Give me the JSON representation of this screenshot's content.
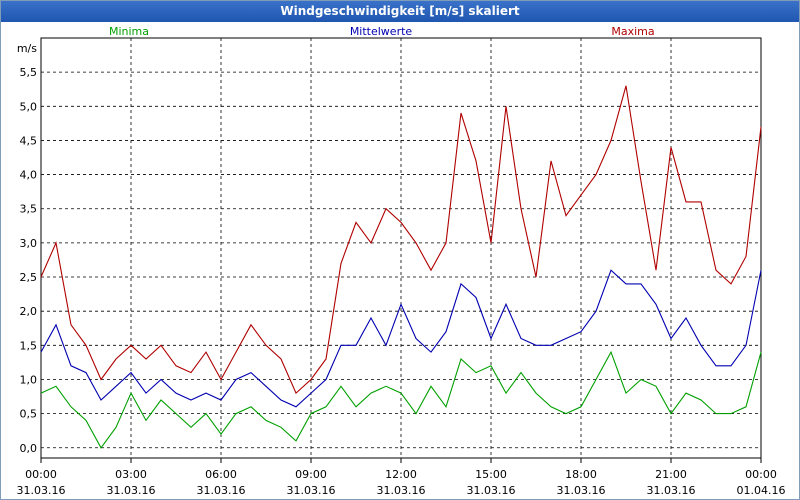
{
  "window": {
    "title": "Windgeschwindigkeit [m/s] skaliert"
  },
  "chart_data": {
    "type": "line",
    "title": "Windgeschwindigkeit [m/s] skaliert",
    "ylabel": "m/s",
    "ylim": [
      -0.15,
      6.0
    ],
    "yticks": [
      "0,0",
      "0,5",
      "1,0",
      "1,5",
      "2,0",
      "2,5",
      "3,0",
      "3,5",
      "4,0",
      "4,5",
      "5,0",
      "5,5"
    ],
    "ytick_values": [
      0,
      0.5,
      1.0,
      1.5,
      2.0,
      2.5,
      3.0,
      3.5,
      4.0,
      4.5,
      5.0,
      5.5
    ],
    "x_ticks": [
      {
        "time": "00:00",
        "date": "31.03.16"
      },
      {
        "time": "03:00",
        "date": "31.03.16"
      },
      {
        "time": "06:00",
        "date": "31.03.16"
      },
      {
        "time": "09:00",
        "date": "31.03.16"
      },
      {
        "time": "12:00",
        "date": "31.03.16"
      },
      {
        "time": "15:00",
        "date": "31.03.16"
      },
      {
        "time": "18:00",
        "date": "31.03.16"
      },
      {
        "time": "21:00",
        "date": "31.03.16"
      },
      {
        "time": "00:00",
        "date": "01.04.16"
      }
    ],
    "x_hours": [
      0,
      0.5,
      1,
      1.5,
      2,
      2.5,
      3,
      3.5,
      4,
      4.5,
      5,
      5.5,
      6,
      6.5,
      7,
      7.5,
      8,
      8.5,
      9,
      9.5,
      10,
      10.5,
      11,
      11.5,
      12,
      12.5,
      13,
      13.5,
      14,
      14.5,
      15,
      15.5,
      16,
      16.5,
      17,
      17.5,
      18,
      18.5,
      19,
      19.5,
      20,
      20.5,
      21,
      21.5,
      22,
      22.5,
      23,
      23.5,
      24
    ],
    "grid": true,
    "legend_position": "top",
    "series": [
      {
        "name": "Minima",
        "color": "#00a000",
        "values": [
          0.8,
          0.9,
          0.6,
          0.4,
          0.0,
          0.3,
          0.8,
          0.4,
          0.7,
          0.5,
          0.3,
          0.5,
          0.2,
          0.5,
          0.6,
          0.4,
          0.3,
          0.1,
          0.5,
          0.6,
          0.9,
          0.6,
          0.8,
          0.9,
          0.8,
          0.5,
          0.9,
          0.6,
          1.3,
          1.1,
          1.2,
          0.8,
          1.1,
          0.8,
          0.6,
          0.5,
          0.6,
          1.0,
          1.4,
          0.8,
          1.0,
          0.9,
          0.5,
          0.8,
          0.7,
          0.5,
          0.5,
          0.6,
          1.4
        ]
      },
      {
        "name": "Mittelwerte",
        "color": "#0000b0",
        "values": [
          1.4,
          1.8,
          1.2,
          1.1,
          0.7,
          0.9,
          1.1,
          0.8,
          1.0,
          0.8,
          0.7,
          0.8,
          0.7,
          1.0,
          1.1,
          0.9,
          0.7,
          0.6,
          0.8,
          1.0,
          1.5,
          1.5,
          1.9,
          1.5,
          2.1,
          1.6,
          1.4,
          1.7,
          2.4,
          2.2,
          1.6,
          2.1,
          1.6,
          1.5,
          1.5,
          1.6,
          1.7,
          2.0,
          2.6,
          2.4,
          2.4,
          2.1,
          1.6,
          1.9,
          1.5,
          1.2,
          1.2,
          1.5,
          2.6
        ]
      },
      {
        "name": "Maxima",
        "color": "#b00000",
        "values": [
          2.5,
          3.0,
          1.8,
          1.5,
          1.0,
          1.3,
          1.5,
          1.3,
          1.5,
          1.2,
          1.1,
          1.4,
          1.0,
          1.4,
          1.8,
          1.5,
          1.3,
          0.8,
          1.0,
          1.3,
          2.7,
          3.3,
          3.0,
          3.5,
          3.3,
          3.0,
          2.6,
          3.0,
          4.9,
          4.2,
          3.0,
          5.0,
          3.5,
          2.5,
          4.2,
          3.4,
          3.7,
          4.0,
          4.5,
          5.3,
          3.9,
          2.6,
          4.4,
          3.6,
          3.6,
          2.6,
          2.4,
          2.8,
          4.7
        ]
      }
    ]
  }
}
